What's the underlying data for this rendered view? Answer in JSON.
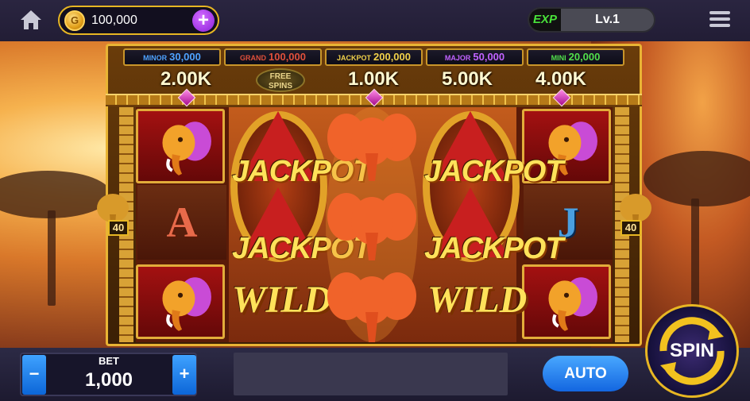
{
  "header": {
    "coin_icon_letter": "G",
    "coin_balance": "100,000",
    "add_coins_label": "+",
    "exp_label": "EXP",
    "level": "Lv.1"
  },
  "jackpots": [
    {
      "name": "MINOR",
      "value": "30,000",
      "color": "#4fa3ff"
    },
    {
      "name": "GRAND",
      "value": "100,000",
      "color": "#e0503b"
    },
    {
      "name": "JACKPOT",
      "value": "200,000",
      "color": "#f2d24a"
    },
    {
      "name": "MAJOR",
      "value": "50,000",
      "color": "#c163ff"
    },
    {
      "name": "MINI",
      "value": "20,000",
      "color": "#52e04b"
    }
  ],
  "column_prizes": [
    "2.00K",
    "1.00K",
    "5.00K",
    "4.00K"
  ],
  "free_spins_label": "FREE SPINS",
  "reels": {
    "left_column": [
      "elephant",
      "A",
      "elephant"
    ],
    "right_column": [
      "elephant",
      "J",
      "elephant"
    ],
    "jackpot_label": "JACKPOT",
    "wild_label": "WILD"
  },
  "side_multipliers": {
    "left": "40",
    "right": "40"
  },
  "bet": {
    "label": "BET",
    "value": "1,000",
    "minus_label": "−",
    "plus_label": "+"
  },
  "auto_label": "AUTO",
  "spin_label": "SPIN"
}
